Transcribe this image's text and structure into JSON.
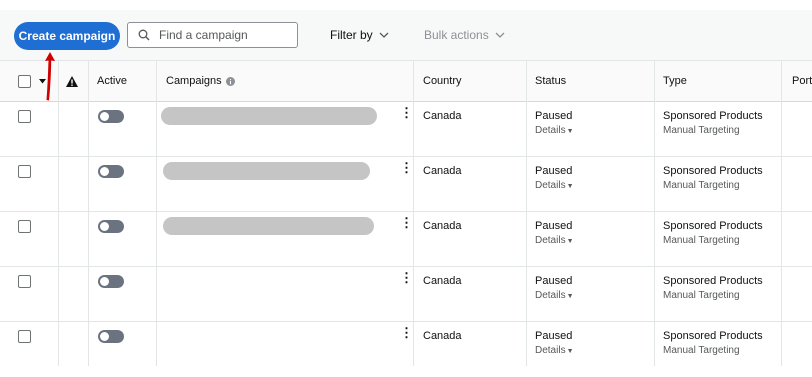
{
  "toolbar": {
    "create_label": "Create campaign",
    "search_placeholder": "Find a campaign",
    "filter_label": "Filter by",
    "bulk_label": "Bulk actions"
  },
  "table": {
    "headers": {
      "active": "Active",
      "campaigns": "Campaigns",
      "country": "Country",
      "status": "Status",
      "type": "Type",
      "portfolio": "Portf"
    },
    "rows": [
      {
        "country": "Canada",
        "status": "Paused",
        "details": "Details",
        "type": "Sponsored Products",
        "targeting": "Manual Targeting"
      },
      {
        "country": "Canada",
        "status": "Paused",
        "details": "Details",
        "type": "Sponsored Products",
        "targeting": "Manual Targeting"
      },
      {
        "country": "Canada",
        "status": "Paused",
        "details": "Details",
        "type": "Sponsored Products",
        "targeting": "Manual Targeting"
      },
      {
        "country": "Canada",
        "status": "Paused",
        "details": "Details",
        "type": "Sponsored Products",
        "targeting": "Manual Targeting"
      },
      {
        "country": "Canada",
        "status": "Paused",
        "details": "Details",
        "type": "Sponsored Products",
        "targeting": "Manual Targeting"
      }
    ]
  },
  "colors": {
    "primary": "#1f6ed4",
    "annotation_arrow": "#d00000",
    "toggle_off": "#6b7280",
    "redacted": "#c5c5c5"
  },
  "icons": [
    "search-icon",
    "chevron-down-icon",
    "warning-icon",
    "info-icon",
    "kebab-menu-icon",
    "caret-down-icon"
  ]
}
